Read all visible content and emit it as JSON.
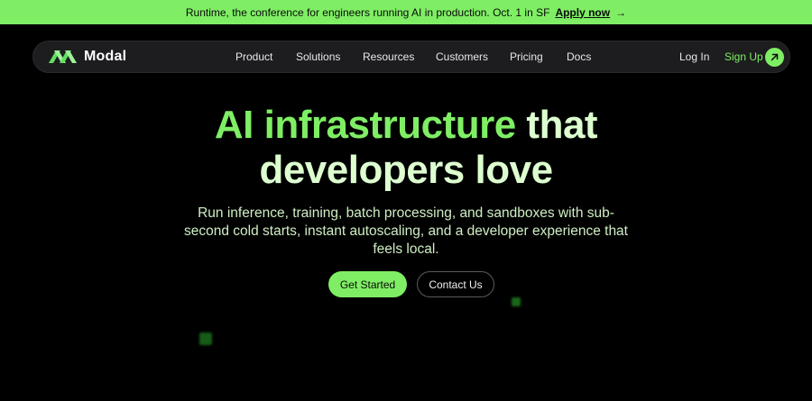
{
  "banner": {
    "text": "Runtime, the conference for engineers running AI in production. Oct. 1 in SF",
    "link": "Apply now",
    "arrow": "→"
  },
  "nav": {
    "logo_text": "Modal",
    "items": [
      "Product",
      "Solutions",
      "Resources",
      "Customers",
      "Pricing",
      "Docs"
    ],
    "login": "Log In",
    "signup": "Sign Up",
    "signup_icon": "arrow-up-right-icon"
  },
  "hero": {
    "title_accent": "AI infrastructure",
    "title_rest_line1": " that",
    "title_line2": "developers love",
    "subtitle": "Run inference, training, batch processing, and sandboxes with sub-second cold starts, instant autoscaling, and a developer experience that feels local.",
    "primary_button": "Get Started",
    "secondary_button": "Contact Us"
  },
  "colors": {
    "accent": "#7fee64",
    "background": "#000000",
    "nav_background": "#1d1d1f",
    "title_text": "#ddffd0"
  }
}
